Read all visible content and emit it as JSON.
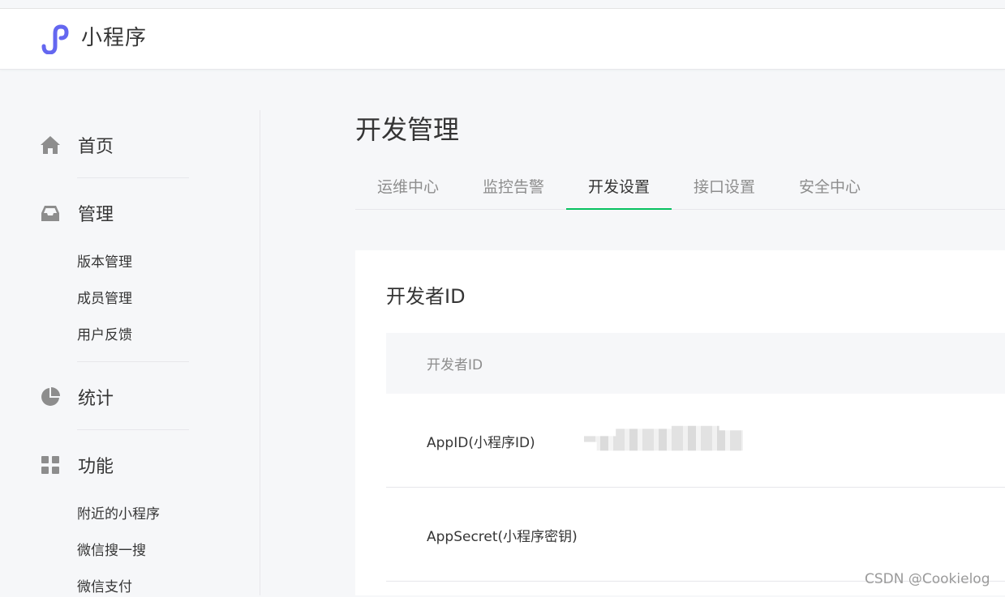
{
  "header": {
    "brand": "小程序",
    "logo_icon": "miniprogram-logo-icon",
    "accent": "#6467f0"
  },
  "sidebar": {
    "sections": [
      {
        "label": "首页",
        "icon": "home-icon",
        "items": []
      },
      {
        "label": "管理",
        "icon": "inbox-icon",
        "items": [
          "版本管理",
          "成员管理",
          "用户反馈"
        ]
      },
      {
        "label": "统计",
        "icon": "pie-chart-icon",
        "items": []
      },
      {
        "label": "功能",
        "icon": "grid-icon",
        "items": [
          "附近的小程序",
          "微信搜一搜",
          "微信支付"
        ]
      }
    ]
  },
  "main": {
    "title": "开发管理",
    "tabs": [
      "运维中心",
      "监控告警",
      "开发设置",
      "接口设置",
      "安全中心"
    ],
    "active_tab": "开发设置",
    "tab_accent": "#07c160",
    "card": {
      "title": "开发者ID",
      "table_header": "开发者ID",
      "rows": [
        {
          "key": "AppID(小程序ID)"
        },
        {
          "key": "AppSecret(小程序密钥)"
        }
      ]
    }
  },
  "watermark": "CSDN @Cookielog"
}
